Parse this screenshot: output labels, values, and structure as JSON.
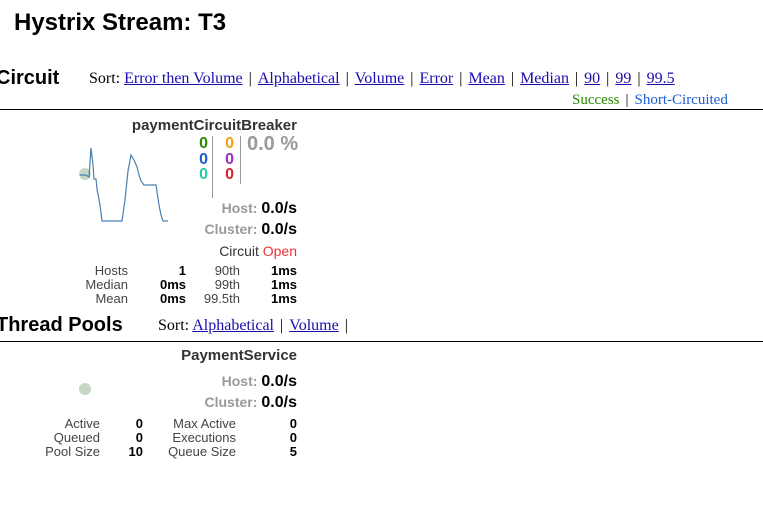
{
  "page": {
    "title": "Hystrix Stream: T3"
  },
  "colors": {
    "success": "#2a8a00",
    "short_circuited": "#1b5dd0",
    "bad_request": "#26c9a6",
    "timeout": "#f2a00b",
    "rejected": "#9b2dbe",
    "failure": "#d9232e",
    "link": "#1a0dab",
    "circuit_open": "#e8353b",
    "sparkline": "#4a7fb0"
  },
  "circuit_section": {
    "title": "Circuit",
    "sort_label": "Sort:",
    "sort_links": [
      "Error then Volume",
      "Alphabetical",
      "Volume",
      "Error",
      "Mean",
      "Median",
      "90",
      "99",
      "99.5"
    ],
    "legend": [
      "Success",
      "Short-Circuited"
    ]
  },
  "circuit": {
    "name": "paymentCircuitBreaker",
    "counts_left": [
      "0",
      "0",
      "0"
    ],
    "counts_right": [
      "0",
      "0",
      "0"
    ],
    "error_rate": "0.0 %",
    "host_label": "Host:",
    "host_rate": "0.0/s",
    "cluster_label": "Cluster:",
    "cluster_rate": "0.0/s",
    "circuit_label": "Circuit",
    "circuit_status": "Open",
    "stats": {
      "hosts_label": "Hosts",
      "hosts_value": "1",
      "median_label": "Median",
      "median_value": "0ms",
      "mean_label": "Mean",
      "mean_value": "0ms",
      "p90_label": "90th",
      "p90_value": "1ms",
      "p99_label": "99th",
      "p99_value": "1ms",
      "p995_label": "99.5th",
      "p995_value": "1ms"
    }
  },
  "thread_section": {
    "title": "Thread Pools",
    "sort_label": "Sort:",
    "sort_links": [
      "Alphabetical",
      "Volume"
    ]
  },
  "pool": {
    "name": "PaymentService",
    "host_label": "Host:",
    "host_rate": "0.0/s",
    "cluster_label": "Cluster:",
    "cluster_rate": "0.0/s",
    "stats": {
      "active_label": "Active",
      "active_value": "0",
      "queued_label": "Queued",
      "queued_value": "0",
      "pool_size_label": "Pool Size",
      "pool_size_value": "10",
      "max_active_label": "Max Active",
      "max_active_value": "0",
      "executions_label": "Executions",
      "executions_value": "0",
      "queue_size_label": "Queue Size",
      "queue_size_value": "5"
    }
  }
}
